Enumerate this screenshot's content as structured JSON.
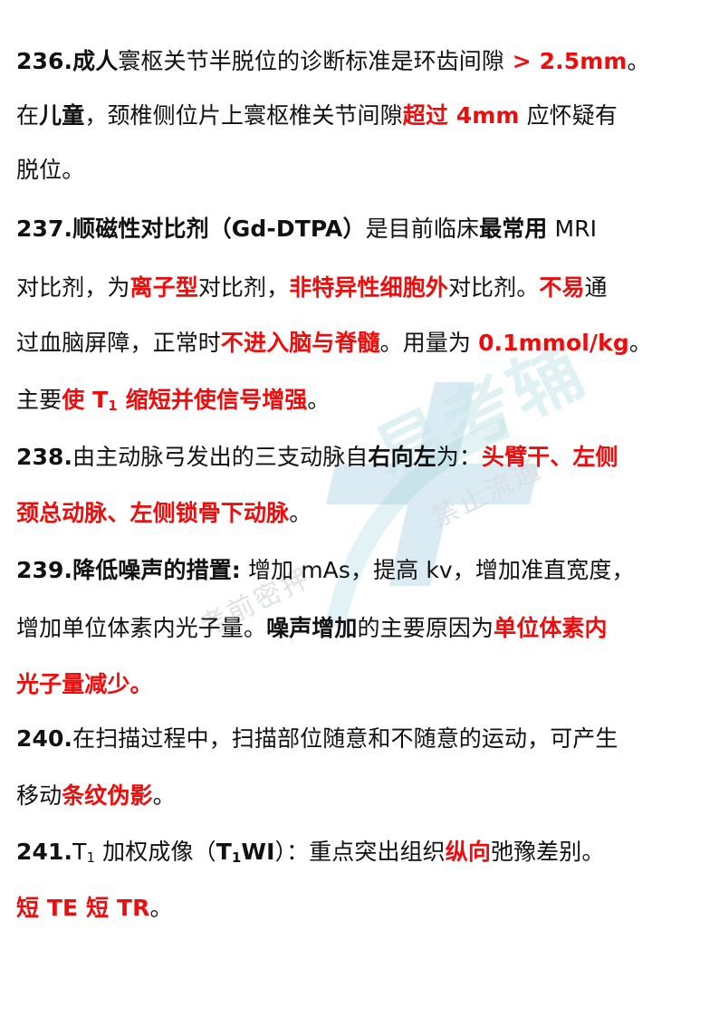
{
  "watermark": {
    "brand": "易考辅",
    "left_text": "考前密押",
    "right_text": "禁止流通",
    "logo_icon": "plus-logo-icon",
    "colors": {
      "logo_blue": "#5aa4c8",
      "logo_teal": "#9bd2d6",
      "text": "#d9dfe3"
    }
  },
  "colors": {
    "highlight": "#ee0d0d",
    "body": "#111111"
  },
  "items": {
    "i236": {
      "num": "236.",
      "a": "成人",
      "b": "寰枢关节半脱位的诊断标准是环齿间隙",
      "c": " > 2.5mm",
      "d": "。",
      "e": "在",
      "f": "儿童",
      "g": "，颈椎侧位片上寰枢椎关节间隙",
      "h": "超过 4mm",
      "i": " 应怀疑有",
      "j": "脱位。"
    },
    "i237": {
      "num": "237.",
      "a": "顺磁性对比剂（Gd-DTPA）",
      "b": "是目前临床",
      "c": "最常用",
      "d": " MRI",
      "e": "对比剂，为",
      "f": "离子型",
      "g": "对比剂，",
      "h": "非特异性细胞外",
      "i": "对比剂。",
      "j": "不易",
      "k": "通",
      "l": "过血脑屏障，正常时",
      "m": "不进入脑与脊髓",
      "n": "。用量为 ",
      "o": "0.1mmol/kg",
      "p": "。",
      "q": "主要",
      "r1": "使 T",
      "r_sub": "1",
      "r2": " 缩短并使信号增强",
      "s": "。"
    },
    "i238": {
      "num": "238.",
      "a": "由主动脉弓发出的三支动脉自",
      "b": "右向左",
      "c": "为：",
      "d": "头臂干、左侧",
      "e": "颈总动脉、左侧锁骨下动脉",
      "f": "。"
    },
    "i239": {
      "num": "239.",
      "a": "降低噪声的措置:",
      "b": " 增加 mAs，提高 kv，增加准直宽度，",
      "c": "增加单位体素内光子量。",
      "d": "噪声增加",
      "e": "的主要原因为",
      "f": "单位体素内",
      "g": "光子量减少。"
    },
    "i240": {
      "num": "240.",
      "a": "在扫描过程中，扫描部位随意和不随意的运动，可产生",
      "b": "移动",
      "c": "条纹伪影",
      "d": "。"
    },
    "i241": {
      "num": "241.",
      "a1": "T",
      "a_sub": "1",
      "a2": " 加权成像（",
      "b1": "T",
      "b_sub": "1",
      "b2": "WI",
      "c": "）：重点突出组织",
      "d": "纵向",
      "e": "弛豫差别。",
      "f": "短 TE 短 TR",
      "g": "。"
    }
  }
}
